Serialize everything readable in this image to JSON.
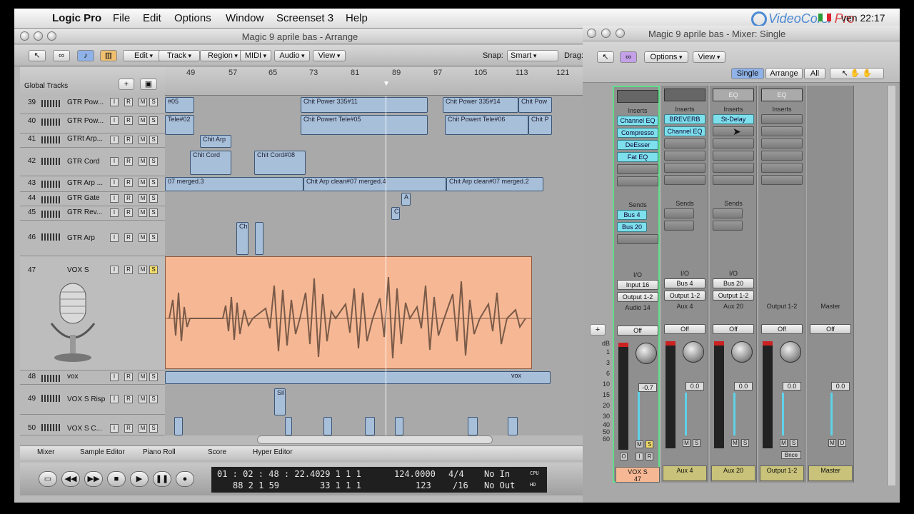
{
  "menubar": {
    "app": "Logic Pro",
    "items": [
      "File",
      "Edit",
      "Options",
      "Window",
      "Screenset 3",
      "Help"
    ],
    "clock": "ven 22:17",
    "logo_main": "VideoCorsi",
    "logo_accent": "Pro"
  },
  "arrange": {
    "title": "Magic 9 aprile bas - Arrange",
    "toolbar": {
      "edit": "Edit",
      "track": "Track",
      "region": "Region",
      "midi": "MIDI",
      "audio": "Audio",
      "view": "View",
      "snap_label": "Snap:",
      "snap_value": "Smart",
      "drag_label": "Drag:"
    },
    "global_tracks": "Global Tracks",
    "ruler": [
      "49",
      "57",
      "65",
      "73",
      "81",
      "89",
      "97",
      "105",
      "113",
      "121"
    ],
    "tracks": [
      {
        "num": "39",
        "name": "GTR Pow..."
      },
      {
        "num": "40",
        "name": "GTR Pow..."
      },
      {
        "num": "41",
        "name": "GTRt Arp..."
      },
      {
        "num": "42",
        "name": "GTR Cord"
      },
      {
        "num": "43",
        "name": "GTR Arp ..."
      },
      {
        "num": "44",
        "name": "GTR Gate"
      },
      {
        "num": "45",
        "name": "GTR Rev..."
      },
      {
        "num": "46",
        "name": "GTR Arp"
      },
      {
        "num": "47",
        "name": "VOX S"
      },
      {
        "num": "48",
        "name": "vox"
      },
      {
        "num": "49",
        "name": "VOX S Risp"
      },
      {
        "num": "50",
        "name": "VOX S C..."
      }
    ],
    "regions": {
      "r39a": "#05",
      "r39b": "Chit Power 335#11",
      "r39c": "Chit Power 335#14",
      "r39d": "Chit Pow",
      "r40a": "Tele#02",
      "r40b": "Chit Powert Tele#05",
      "r40c": "Chit Powert Tele#06",
      "r40d": "Chit P",
      "r41": "Chit Arp",
      "r42a": "Chit Cord",
      "r42b": "Chit Cord#08",
      "r43a": "07 merged.3",
      "r43b": "Chit Arp clean#07 merged.4",
      "r43c": "Chit Arp clean#07 merged.2",
      "r44": "A",
      "r45": "C",
      "r46": "Ch",
      "r48": "vox",
      "r49": "Sil"
    },
    "tabs": [
      "Mixer",
      "Sample Editor",
      "Piano Roll",
      "Score",
      "Hyper Editor"
    ],
    "transport": {
      "smpte": "01 : 02 : 48 : 22.40",
      "bars": "88   2   1   59",
      "pos1": "29   1   1   1",
      "pos2": "33   1   1   1",
      "tempo": "124.0000",
      "tempo2": "123",
      "sig": "4/4",
      "div": "/16",
      "in": "No In",
      "out": "No Out",
      "cpu": "CPU",
      "hd": "HD"
    }
  },
  "mixer": {
    "title": "Magic 9 aprile bas - Mixer: Single",
    "toolbar": {
      "options": "Options",
      "view": "View",
      "single": "Single",
      "arrange": "Arrange",
      "all": "All"
    },
    "strips": [
      {
        "inserts": [
          "Channel EQ",
          "Compresso",
          "DeEsser",
          "Fat EQ"
        ],
        "sends": [
          "Bus 4",
          "Bus 20"
        ],
        "input": "Input 16",
        "output": "Output 1-2",
        "group": "Audio 14",
        "auto": "Off",
        "val": "-0.7",
        "name": "VOX S",
        "sub": "47",
        "hd": ""
      },
      {
        "inserts": [
          "BREVERB",
          "Channel EQ"
        ],
        "sends": [],
        "input": "Bus 4",
        "output": "Output 1-2",
        "group": "Aux 4",
        "auto": "Off",
        "val": "0.0",
        "name": "Aux 4",
        "sub": "",
        "hd": ""
      },
      {
        "inserts": [
          "St-Delay"
        ],
        "sends": [],
        "input": "Bus 20",
        "output": "Output 1-2",
        "group": "Aux 20",
        "auto": "Off",
        "val": "0.0",
        "name": "Aux 20",
        "sub": "",
        "hd": "EQ"
      },
      {
        "inserts": [],
        "sends": [],
        "input": "",
        "output": "",
        "group": "Output 1-2",
        "auto": "Off",
        "val": "0.0",
        "name": "Output 1-2",
        "sub": "",
        "hd": "EQ",
        "bnce": "Bnce"
      },
      {
        "inserts": [],
        "sends": [],
        "input": "",
        "output": "",
        "group": "Master",
        "auto": "Off",
        "val": "0.0",
        "name": "Master",
        "sub": "",
        "hd": ""
      }
    ],
    "labels": {
      "inserts": "Inserts",
      "sends": "Sends",
      "io": "I/O"
    },
    "db": [
      "dB",
      "1",
      "3",
      "6",
      "10",
      "15",
      "20",
      "30",
      "40",
      "50",
      "60"
    ]
  }
}
